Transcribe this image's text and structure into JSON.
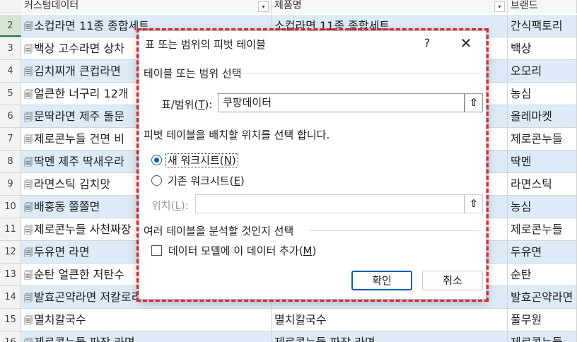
{
  "sheet": {
    "columns": [
      "커스텀데이터",
      "제품명",
      "브랜드"
    ],
    "filter_icon": "▾",
    "row_glyph": "🗐",
    "rows": [
      {
        "num": "2",
        "product": "소컵라면 11종 종합세트",
        "name": "소컵라면 11종 종합세트",
        "brand": "간식팩토리"
      },
      {
        "num": "3",
        "product": "백상 고수라면 상차",
        "name": "",
        "brand": "백상"
      },
      {
        "num": "4",
        "product": "김치찌개 큰컵라면",
        "name": "",
        "brand": "오모리"
      },
      {
        "num": "5",
        "product": "얼큰한 너구리 12개",
        "name": "",
        "brand": "농심"
      },
      {
        "num": "6",
        "product": "문딱라면 제주 돌문",
        "name": "",
        "brand": "올레마켓"
      },
      {
        "num": "7",
        "product": "제로콘누들 건면 비",
        "name": "",
        "brand": "제로콘누들"
      },
      {
        "num": "8",
        "product": "딱멘 제주 딱새우라",
        "name": "",
        "brand": "딱멘"
      },
      {
        "num": "9",
        "product": "라면스틱 김치맛",
        "name": "",
        "brand": "라면스틱"
      },
      {
        "num": "10",
        "product": "배홍동 쫄쫄면",
        "name": "",
        "brand": "농심"
      },
      {
        "num": "11",
        "product": "제로콘누들 사천짜장",
        "name": "",
        "brand": "제로콘누들"
      },
      {
        "num": "12",
        "product": "두유면 라면",
        "name": "",
        "brand": "두유면"
      },
      {
        "num": "13",
        "product": "순탄 얼큰한 저탄수",
        "name": "",
        "brand": "순탄"
      },
      {
        "num": "14",
        "product": "발효곤약라면 저칼로리",
        "name": "",
        "brand": "발효곤약라면"
      },
      {
        "num": "15",
        "product": "멸치칼국수",
        "name": "멸치칼국수",
        "brand": "풀무원"
      },
      {
        "num": "16",
        "product": "제로콘누들 파장 라면",
        "name": "제로콘누들 파장 라면",
        "brand": "제로콘누들"
      }
    ]
  },
  "dialog": {
    "title": "표 또는 범위의 피벗 테이블",
    "help_icon": "?",
    "close_icon": "✕",
    "source_group": "테이블 또는 범위 선택",
    "table_range_label": "표/범위",
    "table_range_key": "T",
    "table_range_value": "쿠팡데이터",
    "collapse_icon": "⇧",
    "placement_group": "피벗 테이블을 배치할 위치를 선택 합니다.",
    "new_sheet_label": "새 워크시트",
    "new_sheet_key": "N",
    "existing_sheet_label": "기존 워크시트",
    "existing_sheet_key": "E",
    "location_label": "위치",
    "location_key": "L",
    "location_value": "",
    "analyze_group": "여러 테이블을 분석할 것인지 선택",
    "data_model_label": "데이터 모델에 이 데이터 추가",
    "data_model_key": "M",
    "ok_label": "확인",
    "cancel_label": "취소",
    "grip_icon": "⋰"
  }
}
